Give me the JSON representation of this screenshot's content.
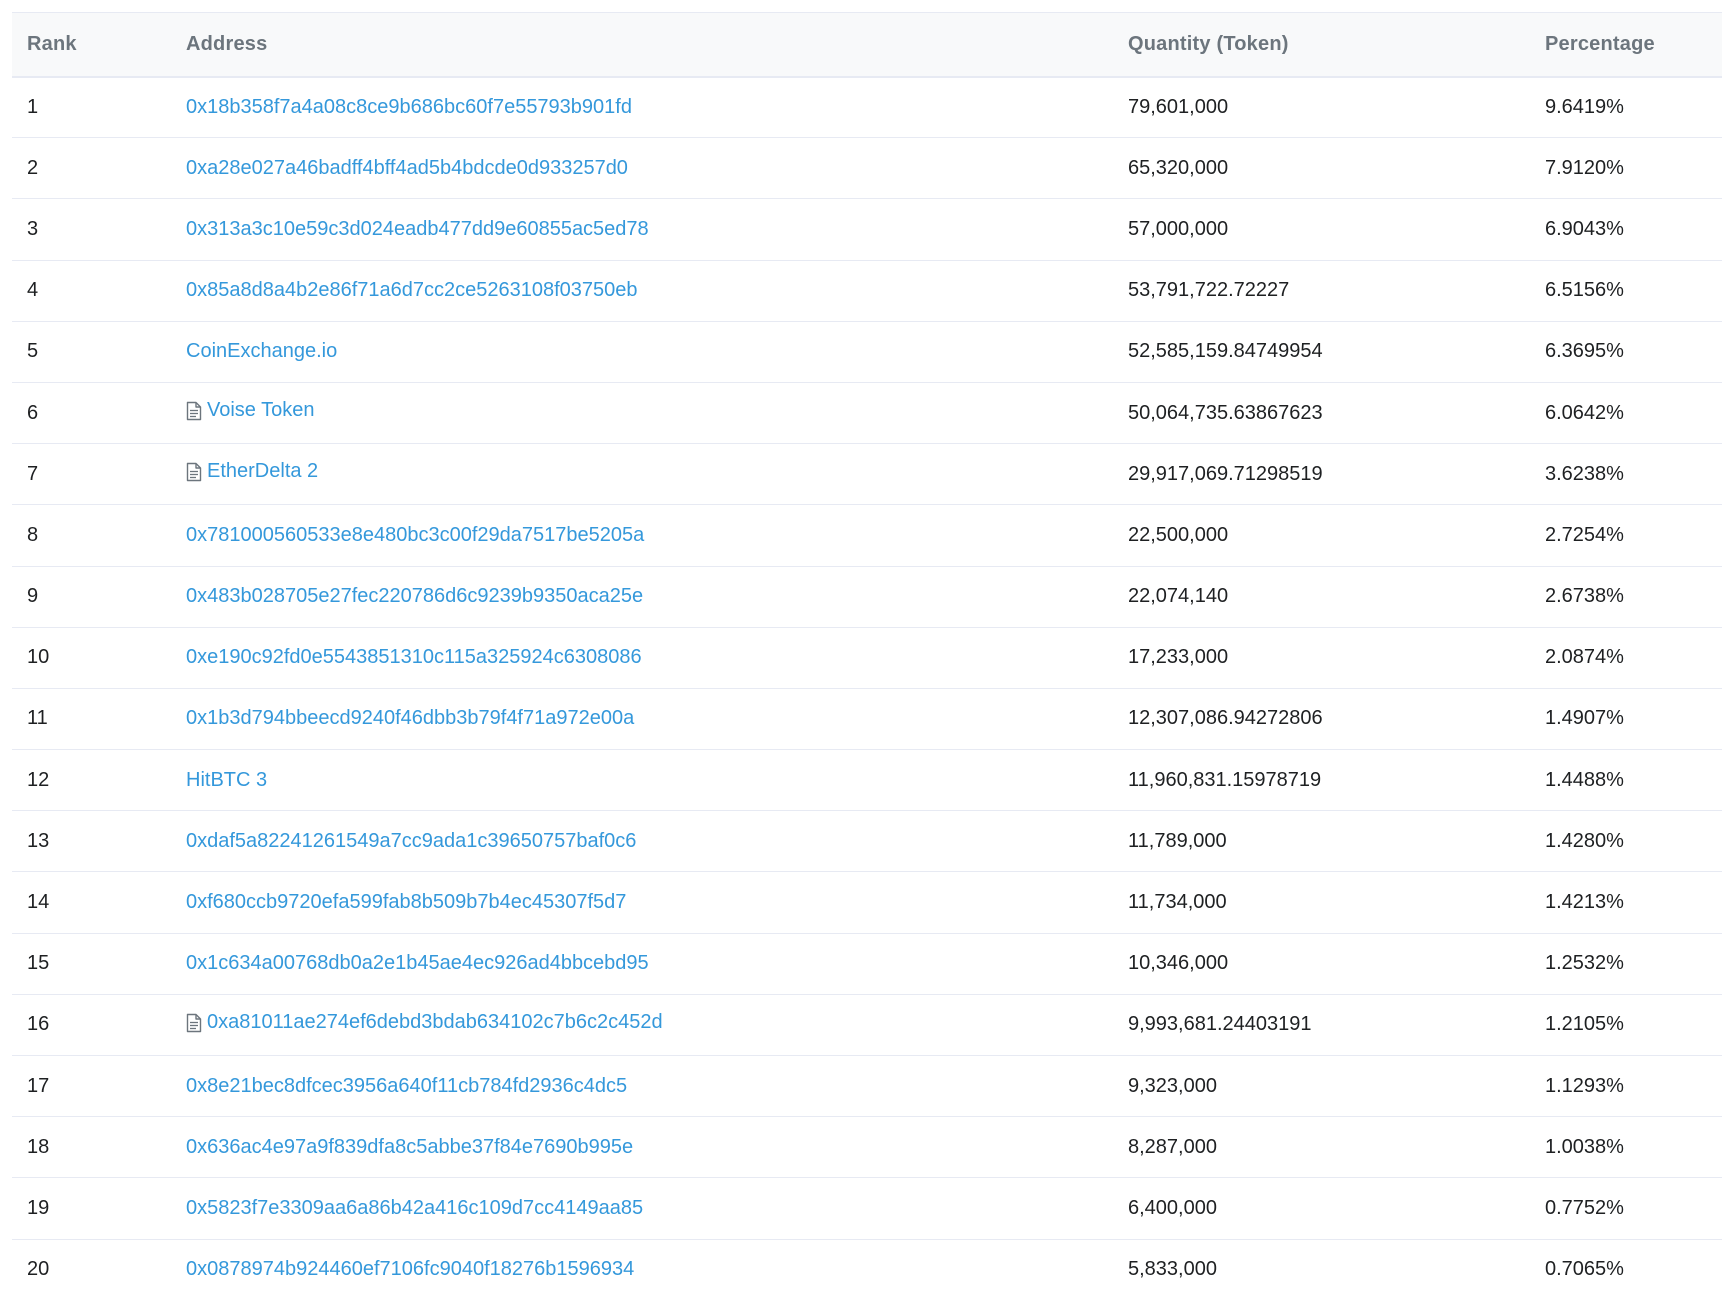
{
  "table": {
    "headers": {
      "rank": "Rank",
      "address": "Address",
      "quantity": "Quantity (Token)",
      "percentage": "Percentage"
    },
    "rows": [
      {
        "rank": "1",
        "address": "0x18b358f7a4a08c8ce9b686bc60f7e55793b901fd",
        "contract": false,
        "quantity": "79,601,000",
        "percentage": "9.6419%"
      },
      {
        "rank": "2",
        "address": "0xa28e027a46badff4bff4ad5b4bdcde0d933257d0",
        "contract": false,
        "quantity": "65,320,000",
        "percentage": "7.9120%"
      },
      {
        "rank": "3",
        "address": "0x313a3c10e59c3d024eadb477dd9e60855ac5ed78",
        "contract": false,
        "quantity": "57,000,000",
        "percentage": "6.9043%"
      },
      {
        "rank": "4",
        "address": "0x85a8d8a4b2e86f71a6d7cc2ce5263108f03750eb",
        "contract": false,
        "quantity": "53,791,722.72227",
        "percentage": "6.5156%"
      },
      {
        "rank": "5",
        "address": "CoinExchange.io",
        "contract": false,
        "quantity": "52,585,159.84749954",
        "percentage": "6.3695%"
      },
      {
        "rank": "6",
        "address": "Voise Token",
        "contract": true,
        "quantity": "50,064,735.63867623",
        "percentage": "6.0642%"
      },
      {
        "rank": "7",
        "address": "EtherDelta 2",
        "contract": true,
        "quantity": "29,917,069.71298519",
        "percentage": "3.6238%"
      },
      {
        "rank": "8",
        "address": "0x781000560533e8e480bc3c00f29da7517be5205a",
        "contract": false,
        "quantity": "22,500,000",
        "percentage": "2.7254%"
      },
      {
        "rank": "9",
        "address": "0x483b028705e27fec220786d6c9239b9350aca25e",
        "contract": false,
        "quantity": "22,074,140",
        "percentage": "2.6738%"
      },
      {
        "rank": "10",
        "address": "0xe190c92fd0e5543851310c115a325924c6308086",
        "contract": false,
        "quantity": "17,233,000",
        "percentage": "2.0874%"
      },
      {
        "rank": "11",
        "address": "0x1b3d794bbeecd9240f46dbb3b79f4f71a972e00a",
        "contract": false,
        "quantity": "12,307,086.94272806",
        "percentage": "1.4907%"
      },
      {
        "rank": "12",
        "address": "HitBTC 3",
        "contract": false,
        "quantity": "11,960,831.15978719",
        "percentage": "1.4488%"
      },
      {
        "rank": "13",
        "address": "0xdaf5a82241261549a7cc9ada1c39650757baf0c6",
        "contract": false,
        "quantity": "11,789,000",
        "percentage": "1.4280%"
      },
      {
        "rank": "14",
        "address": "0xf680ccb9720efa599fab8b509b7b4ec45307f5d7",
        "contract": false,
        "quantity": "11,734,000",
        "percentage": "1.4213%"
      },
      {
        "rank": "15",
        "address": "0x1c634a00768db0a2e1b45ae4ec926ad4bbcebd95",
        "contract": false,
        "quantity": "10,346,000",
        "percentage": "1.2532%"
      },
      {
        "rank": "16",
        "address": "0xa81011ae274ef6debd3bdab634102c7b6c2c452d",
        "contract": true,
        "quantity": "9,993,681.24403191",
        "percentage": "1.2105%"
      },
      {
        "rank": "17",
        "address": "0x8e21bec8dfcec3956a640f11cb784fd2936c4dc5",
        "contract": false,
        "quantity": "9,323,000",
        "percentage": "1.1293%"
      },
      {
        "rank": "18",
        "address": "0x636ac4e97a9f839dfa8c5abbe37f84e7690b995e",
        "contract": false,
        "quantity": "8,287,000",
        "percentage": "1.0038%"
      },
      {
        "rank": "19",
        "address": "0x5823f7e3309aa6a86b42a416c109d7cc4149aa85",
        "contract": false,
        "quantity": "6,400,000",
        "percentage": "0.7752%"
      },
      {
        "rank": "20",
        "address": "0x0878974b924460ef7106fc9040f18276b1596934",
        "contract": false,
        "quantity": "5,833,000",
        "percentage": "0.7065%"
      }
    ]
  },
  "icons": {
    "contract": "document-icon"
  },
  "colors": {
    "link": "#3498db",
    "header_bg": "#f8f9fa",
    "border": "#e7eaf3",
    "header_text": "#6c757d",
    "text": "#1e2022"
  }
}
